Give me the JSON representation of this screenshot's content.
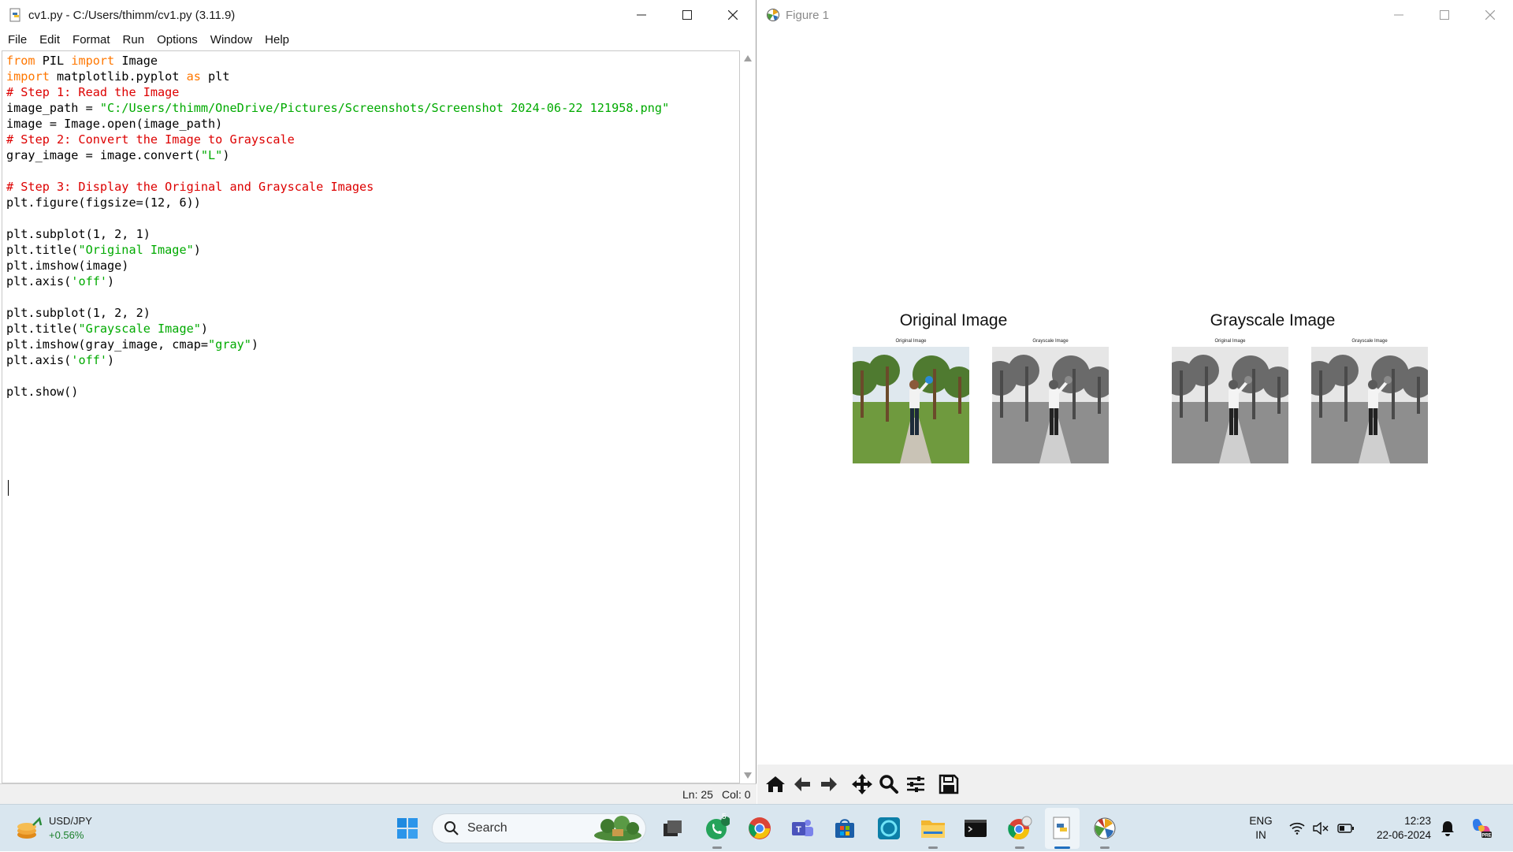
{
  "idle": {
    "title": "cv1.py - C:/Users/thimm/cv1.py (3.11.9)",
    "menu": [
      "File",
      "Edit",
      "Format",
      "Run",
      "Options",
      "Window",
      "Help"
    ],
    "code_lines": [
      [
        [
          "kw",
          "from"
        ],
        [
          "t",
          " PIL "
        ],
        [
          "kw",
          "import"
        ],
        [
          "t",
          " Image"
        ]
      ],
      [
        [
          "kw",
          "import"
        ],
        [
          "t",
          " matplotlib.pyplot "
        ],
        [
          "kw",
          "as"
        ],
        [
          "t",
          " plt"
        ]
      ],
      [
        [
          "cm",
          "# Step 1: Read the Image"
        ]
      ],
      [
        [
          "t",
          "image_path = "
        ],
        [
          "st",
          "\"C:/Users/thimm/OneDrive/Pictures/Screenshots/Screenshot 2024-06-22 121958.png\""
        ]
      ],
      [
        [
          "t",
          "image = Image.open(image_path)"
        ]
      ],
      [
        [
          "cm",
          "# Step 2: Convert the Image to Grayscale"
        ]
      ],
      [
        [
          "t",
          "gray_image = image.convert("
        ],
        [
          "st",
          "\"L\""
        ],
        [
          "t",
          ")"
        ]
      ],
      [],
      [
        [
          "cm",
          "# Step 3: Display the Original and Grayscale Images"
        ]
      ],
      [
        [
          "t",
          "plt.figure(figsize=(12, 6))"
        ]
      ],
      [],
      [
        [
          "t",
          "plt.subplot(1, 2, 1)"
        ]
      ],
      [
        [
          "t",
          "plt.title("
        ],
        [
          "st",
          "\"Original Image\""
        ],
        [
          "t",
          ")"
        ]
      ],
      [
        [
          "t",
          "plt.imshow(image)"
        ]
      ],
      [
        [
          "t",
          "plt.axis("
        ],
        [
          "st",
          "'off'"
        ],
        [
          "t",
          ")"
        ]
      ],
      [],
      [
        [
          "t",
          "plt.subplot(1, 2, 2)"
        ]
      ],
      [
        [
          "t",
          "plt.title("
        ],
        [
          "st",
          "\"Grayscale Image\""
        ],
        [
          "t",
          ")"
        ]
      ],
      [
        [
          "t",
          "plt.imshow(gray_image, cmap="
        ],
        [
          "st",
          "\"gray\""
        ],
        [
          "t",
          ")"
        ]
      ],
      [
        [
          "t",
          "plt.axis("
        ],
        [
          "st",
          "'off'"
        ],
        [
          "t",
          ")"
        ]
      ],
      [],
      [
        [
          "t",
          "plt.show()"
        ]
      ]
    ],
    "status": {
      "line": "Ln: 25",
      "col": "Col: 0"
    },
    "colors": {
      "keyword": "#ff7700",
      "comment": "#dd0000",
      "string": "#00aa00"
    }
  },
  "figure": {
    "title": "Figure 1",
    "subplots": [
      {
        "title": "Original Image",
        "thumbs": [
          {
            "caption": "Original Image",
            "mode": "color"
          },
          {
            "caption": "Grayscale Image",
            "mode": "gray"
          }
        ]
      },
      {
        "title": "Grayscale Image",
        "thumbs": [
          {
            "caption": "Original Image",
            "mode": "gray"
          },
          {
            "caption": "Grayscale Image",
            "mode": "gray"
          }
        ]
      }
    ],
    "toolbar": [
      "home-icon",
      "back-arrow-icon",
      "forward-arrow-icon",
      "pan-icon",
      "zoom-icon",
      "configure-subplots-icon",
      "save-icon"
    ]
  },
  "taskbar": {
    "ticker": {
      "symbol": "USD/JPY",
      "change": "+0.56%"
    },
    "search_placeholder": "Search",
    "whatsapp_badge": "5",
    "language": {
      "line1": "ENG",
      "line2": "IN"
    },
    "clock": {
      "time": "12:23",
      "date": "22-06-2024"
    }
  }
}
